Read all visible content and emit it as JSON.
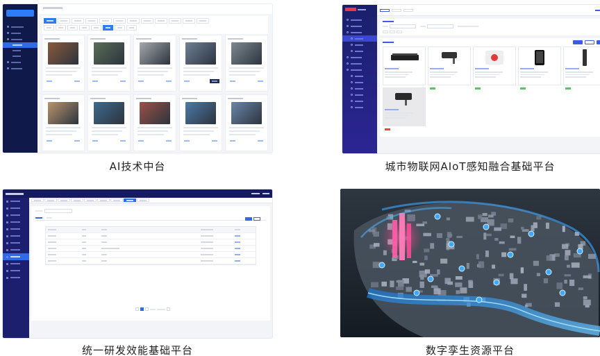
{
  "captions": {
    "ai": "AI技术中台",
    "iot": "城市物联网AIoT感知融合基础平台",
    "dev": "统一研发效能基础平台",
    "twin": "数字孪生资源平台"
  },
  "colors": {
    "ai_sidebar": "#0f1a4a",
    "iot_sidebar": "#1a1f6b",
    "dev_sidebar": "#1c1f6e",
    "accent_blue": "#2f7df6",
    "twin_background": "#1d2530"
  }
}
